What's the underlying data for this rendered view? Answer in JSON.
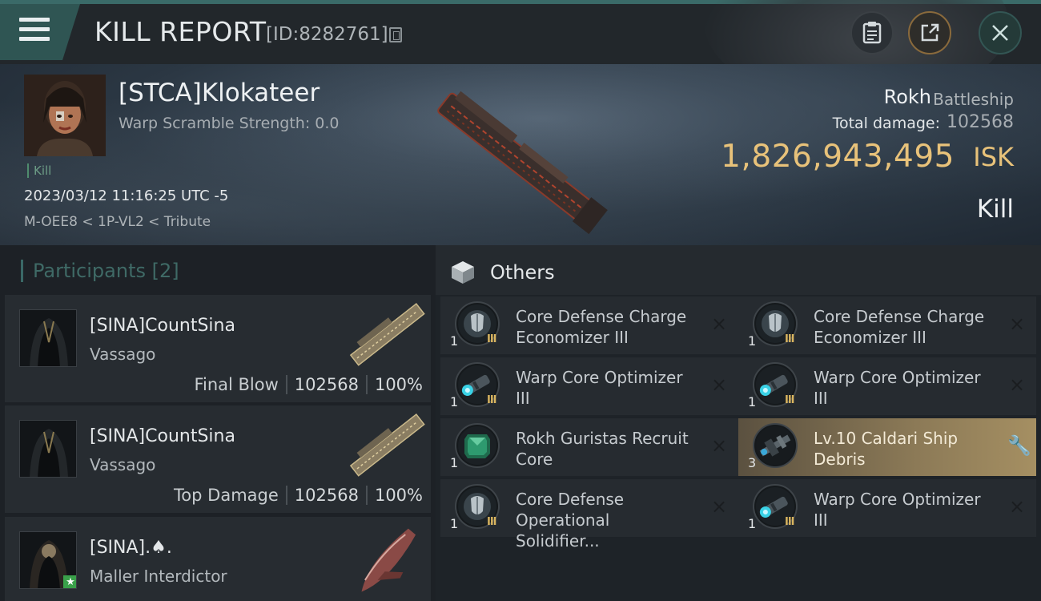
{
  "header": {
    "title": "KILL REPORT",
    "report_id": "[ID:8282761]",
    "buttons": {
      "menu": "menu-icon",
      "clipboard": "clipboard-icon",
      "share": "share-icon",
      "close": "close-icon"
    }
  },
  "victim": {
    "name": "[STCA]Klokateer",
    "warp_scramble": "Warp Scramble Strength: 0.0",
    "kill_tag": "Kill",
    "timestamp": "2023/03/12 11:16:25 UTC -5",
    "location": "M-OEE8 < 1P-VL2 < Tribute",
    "ship_name": "Rokh",
    "ship_class": "Battleship",
    "total_damage_label": "Total damage:",
    "total_damage": "102568",
    "isk_value": "1,826,943,495",
    "isk_unit": "ISK",
    "result": "Kill"
  },
  "participants": {
    "title": "Participants",
    "count": "[2]",
    "items": [
      {
        "name": "[SINA]CountSina",
        "ship": "Vassago",
        "label": "Final Blow",
        "damage": "102568",
        "percent": "100%"
      },
      {
        "name": "[SINA]CountSina",
        "ship": "Vassago",
        "label": "Top Damage",
        "damage": "102568",
        "percent": "100%"
      },
      {
        "name": "[SINA].♠.",
        "ship": "Maller Interdictor"
      }
    ]
  },
  "others": {
    "title": "Others",
    "items": [
      {
        "name": "Core Defense Charge Economizer III",
        "qty": "1",
        "meta": "III",
        "icon": "shield-module-icon",
        "action": "×"
      },
      {
        "name": "Core Defense Charge Economizer III",
        "qty": "1",
        "meta": "III",
        "icon": "shield-module-icon",
        "action": "×"
      },
      {
        "name": "Warp Core Optimizer III",
        "qty": "1",
        "meta": "III",
        "icon": "warp-optimizer-icon",
        "action": "×"
      },
      {
        "name": "Warp Core Optimizer III",
        "qty": "1",
        "meta": "III",
        "icon": "warp-optimizer-icon",
        "action": "×"
      },
      {
        "name": "Rokh Guristas Recruit Core",
        "qty": "1",
        "meta": "",
        "icon": "green-core-icon",
        "action": "×"
      },
      {
        "name": "Lv.10 Caldari Ship Debris",
        "qty": "3",
        "meta": "",
        "icon": "ship-debris-icon",
        "action": "🔧"
      },
      {
        "name": "Core Defense Operational Solidifier...",
        "qty": "1",
        "meta": "III",
        "icon": "shield-module-icon",
        "action": "×"
      },
      {
        "name": "Warp Core Optimizer III",
        "qty": "1",
        "meta": "III",
        "icon": "warp-optimizer-icon",
        "action": "×"
      }
    ]
  }
}
